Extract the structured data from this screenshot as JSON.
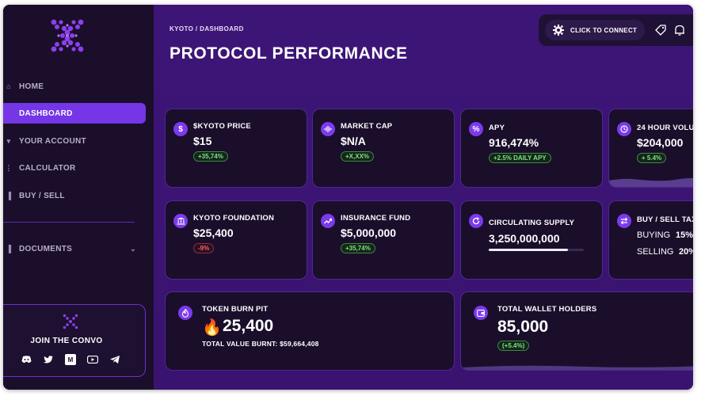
{
  "app": {
    "brand_color": "#7436e6",
    "bg_color": "#3d1577"
  },
  "sidebar": {
    "items": [
      {
        "label": "HOME",
        "icon": "home-icon"
      },
      {
        "label": "DASHBOARD",
        "icon": "dashboard-icon",
        "active": true
      },
      {
        "label": "YOUR ACCOUNT",
        "icon": "account-icon"
      },
      {
        "label": "CALCULATOR",
        "icon": "calculator-icon"
      },
      {
        "label": "BUY / SELL",
        "icon": "buy-sell-icon"
      },
      {
        "label": "DOCUMENTS",
        "icon": "documents-icon"
      }
    ],
    "convo": {
      "title": "JOIN THE CONVO",
      "socials": [
        "discord-icon",
        "twitter-icon",
        "medium-icon",
        "youtube-icon",
        "telegram-icon"
      ]
    }
  },
  "header": {
    "breadcrumb": "KYOTO / DASHBOARD",
    "title": "PROTOCOL PERFORMANCE",
    "connect_label": "CLICK TO CONNECT"
  },
  "cards": {
    "price": {
      "label": "$KYOTO PRICE",
      "value": "$15",
      "badge": "+35,74%",
      "icon": "$"
    },
    "market_cap": {
      "label": "MARKET CAP",
      "value": "$N/A",
      "badge": "+X,XX%"
    },
    "apy": {
      "label": "APY",
      "value": "916,474%",
      "badge": "+2.5% DAILY APY",
      "icon": "%"
    },
    "volume": {
      "label": "24 HOUR VOLU",
      "value": "$204,000",
      "badge": "+ 5.4%"
    },
    "foundation": {
      "label": "KYOTO FOUNDATION",
      "value": "$25,400",
      "badge": "-9%"
    },
    "insurance": {
      "label": "INSURANCE FUND",
      "value": "$5,000,000",
      "badge": "+35,74%"
    },
    "supply": {
      "label": "CIRCULATING SUPPLY",
      "value": "3,250,000,000",
      "progress": 0.83
    },
    "tax": {
      "label": "BUY / SELL TAX",
      "buying_label": "BUYING",
      "buying_value": "15%",
      "selling_label": "SELLING",
      "selling_value": "20%"
    },
    "burn": {
      "label": "TOKEN BURN PIT",
      "emoji": "🔥",
      "value": "25,400",
      "sub": "TOTAL VALUE BURNT: $59,664,408"
    },
    "holders": {
      "label": "TOTAL WALLET HOLDERS",
      "value": "85,000",
      "badge": "(+5.4%)"
    }
  }
}
